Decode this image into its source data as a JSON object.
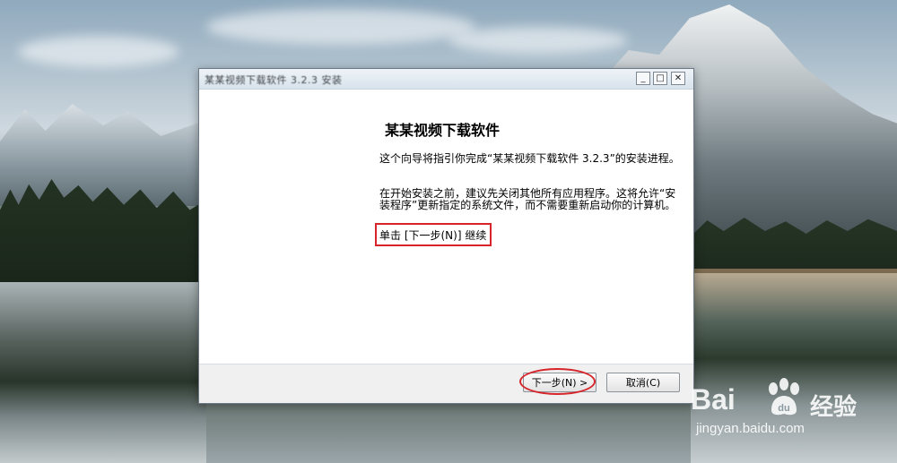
{
  "window": {
    "title": "某某视频下载软件 3.2.3 安装",
    "min_glyph": "_",
    "max_glyph": "□",
    "close_glyph": "✕"
  },
  "content": {
    "heading": "某某视频下载软件",
    "para1": "这个向导将指引你完成“某某视频下载软件 3.2.3”的安装进程。",
    "para2": "在开始安装之前，建议先关闭其他所有应用程序。这将允许“安装程序”更新指定的系统文件，而不需要重新启动你的计算机。",
    "instruction": "单击 [下一步(N)] 继续"
  },
  "buttons": {
    "next": "下一步(N) >",
    "cancel": "取消(C)"
  },
  "annotation_color": "#d6242a",
  "watermark": {
    "logo_text": "Bai",
    "logo_suffix": "du",
    "cn_text": "经验",
    "url": "jingyan.baidu.com"
  }
}
